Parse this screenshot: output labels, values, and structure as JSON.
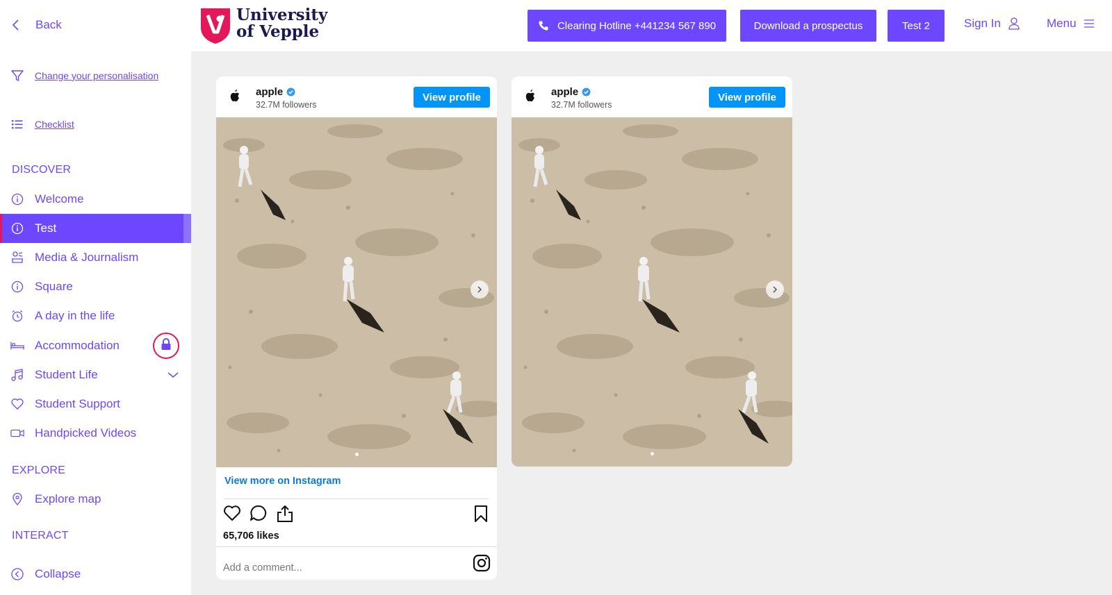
{
  "sidebar": {
    "back_label": "Back",
    "personalisation_label": "Change your personalisation",
    "checklist_label": "Checklist",
    "sections": {
      "discover": "DISCOVER",
      "explore": "EXPLORE",
      "interact": "INTERACT"
    },
    "items": [
      {
        "label": "Welcome",
        "icon": "info-icon"
      },
      {
        "label": "Test",
        "icon": "info-icon",
        "active": true
      },
      {
        "label": "Media & Journalism",
        "icon": "press-icon"
      },
      {
        "label": "Square",
        "icon": "info-icon"
      },
      {
        "label": "A day in the life",
        "icon": "alarm-clock-icon"
      },
      {
        "label": "Accommodation",
        "icon": "bed-icon",
        "locked": true
      },
      {
        "label": "Student Life",
        "icon": "music-note-icon",
        "expandable": true
      },
      {
        "label": "Student Support",
        "icon": "heart-icon"
      },
      {
        "label": "Handpicked Videos",
        "icon": "video-camera-icon"
      }
    ],
    "explore_map_label": "Explore map",
    "collapse_label": "Collapse"
  },
  "header": {
    "logo_line1": "University",
    "logo_line2": "of Vepple",
    "hotline_label": "Clearing Hotline +441234 567 890",
    "prospectus_label": "Download a prospectus",
    "test2_label": "Test 2",
    "signin_label": "Sign In",
    "menu_label": "Menu"
  },
  "colors": {
    "accent": "#6c47ff",
    "brand_red": "#e2185b",
    "instagram_blue": "#0095f6",
    "page_bg": "#efefef"
  },
  "instagram_posts": [
    {
      "username": "apple",
      "followers": "32.7M followers",
      "view_profile_label": "View profile",
      "view_more_label": "View more on Instagram",
      "likes": "65,706 likes",
      "comment_placeholder": "Add a comment..."
    },
    {
      "username": "apple",
      "followers": "32.7M followers",
      "view_profile_label": "View profile"
    }
  ]
}
